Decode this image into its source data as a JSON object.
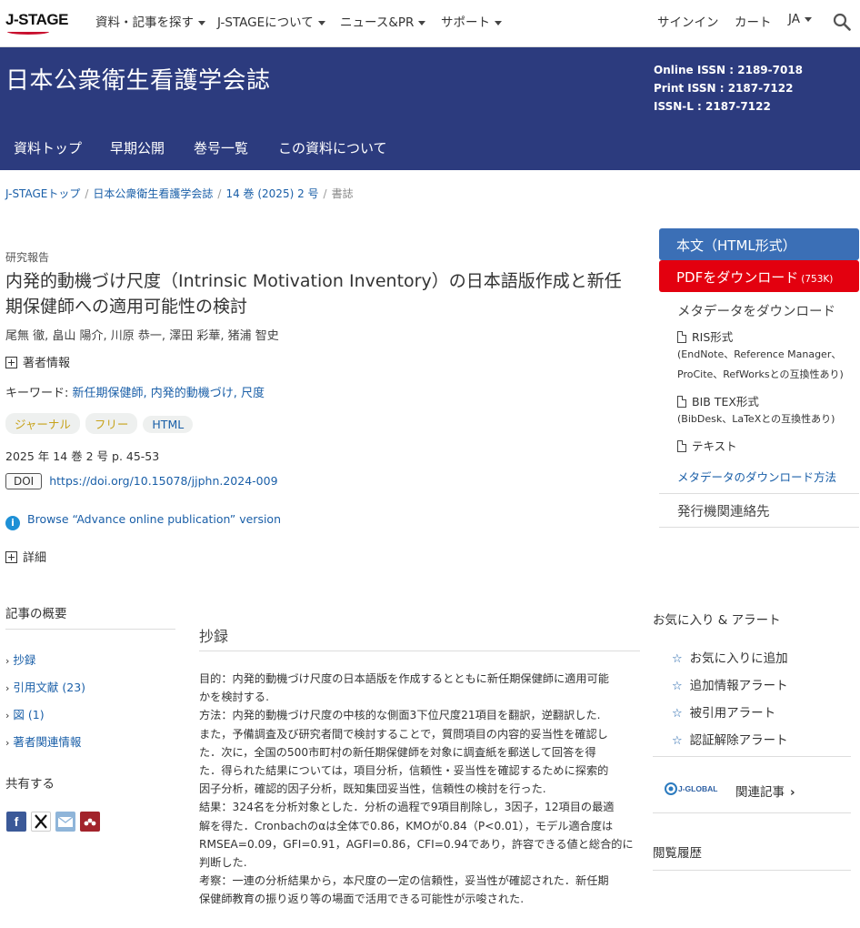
{
  "topnav": {
    "logo_text": "J-STAGE",
    "items": [
      "資料・記事を探す",
      "J-STAGEについて",
      "ニュース&PR",
      "サポート"
    ],
    "signin": "サインイン",
    "cart": "カート",
    "lang": "JA"
  },
  "banner": {
    "title": "日本公衆衛生看護学会誌",
    "issn_online": "Online ISSN : 2189-7018",
    "issn_print": "Print ISSN : 2187-7122",
    "issn_l": "ISSN-L : 2187-7122",
    "tabs": [
      "資料トップ",
      "早期公開",
      "巻号一覧",
      "この資料について"
    ]
  },
  "breadcrumb": [
    "J-STAGEトップ",
    "日本公衆衛生看護学会誌",
    "14 巻 (2025) 2 号",
    "書誌"
  ],
  "article": {
    "category": "研究報告",
    "title": "内発的動機づけ尺度（Intrinsic Motivation Inventory）の日本語版作成と新任期保健師への適用可能性の検討",
    "authors": "尾無 徹, 畠山 陽介, 川原 恭一, 澤田 彩華, 猪浦 智史",
    "author_info": "著者情報",
    "keywords_label": "キーワード:",
    "keywords": "新任期保健師, 内発的動機づけ, 尺度",
    "tags": [
      "ジャーナル",
      "フリー",
      "HTML"
    ],
    "volume": "2025 年 14 巻 2 号 p. 45-53",
    "doi_label": "DOI",
    "doi": "https://doi.org/10.15078/jjphn.2024-009",
    "aop": "Browse “Advance online publication” version",
    "details": "詳細"
  },
  "sidebar_right": {
    "html_btn": "本文（HTML形式）",
    "pdf_btn": "PDFをダウンロード",
    "pdf_size": "(753K)",
    "meta_title": "メタデータをダウンロード",
    "ris": "RIS形式",
    "ris_note1": "(EndNote、Reference Manager、",
    "ris_note2": "ProCite、RefWorksとの互換性あり)",
    "bib": "BIB TEX形式",
    "bib_note": "(BibDesk、LaTeXとの互換性あり)",
    "text": "テキスト",
    "meta_howto": "メタデータのダウンロード方法",
    "publisher": "発行機関連絡先"
  },
  "left_nav": {
    "heading": "記事の概要",
    "links": [
      "抄録",
      "引用文献 (23)",
      "図 (1)",
      "著者関連情報"
    ],
    "share": "共有する"
  },
  "abstract": {
    "heading": "抄録",
    "lines": [
      "目的：内発的動機づけ尺度の日本語版を作成するとともに新任期保健師に適用可能",
      "かを検討する.",
      "方法：内発的動機づけ尺度の中核的な側面3下位尺度21項目を翻訳，逆翻訳した.",
      "また，予備調査及び研究者間で検討することで，質問項目の内容的妥当性を確認し",
      "た．次に，全国の500市町村の新任期保健師を対象に調査紙を郵送して回答を得",
      "た．得られた結果については，項目分析，信頼性・妥当性を確認するために探索的",
      "因子分析，確認的因子分析，既知集団妥当性，信頼性の検討を行った.",
      "結果：324名を分析対象とした．分析の過程で9項目削除し，3因子，12項目の最適",
      "解を得た．Cronbachのαは全体で0.86，KMOが0.84（P<0.01），モデル適合度は",
      "RMSEA=0.09，GFI=0.91，AGFI=0.86，CFI=0.94であり，許容できる値と総合的に",
      "判断した.",
      "考察：一連の分析結果から，本尺度の一定の信頼性，妥当性が確認された．新任期",
      "保健師教育の振り返り等の場面で活用できる可能性が示唆された."
    ]
  },
  "right_lower": {
    "heading": "お気に入り & アラート",
    "items": [
      "お気に入りに追加",
      "追加情報アラート",
      "被引用アラート",
      "認証解除アラート"
    ],
    "related": "関連記事",
    "jglobal": "J-GLOBAL",
    "history": "閲覧履歴"
  },
  "colors": {
    "banner": "#2c3b7e",
    "html_btn": "#3b6fb6",
    "pdf_btn": "#e3000f",
    "link": "#1a5fa8"
  }
}
